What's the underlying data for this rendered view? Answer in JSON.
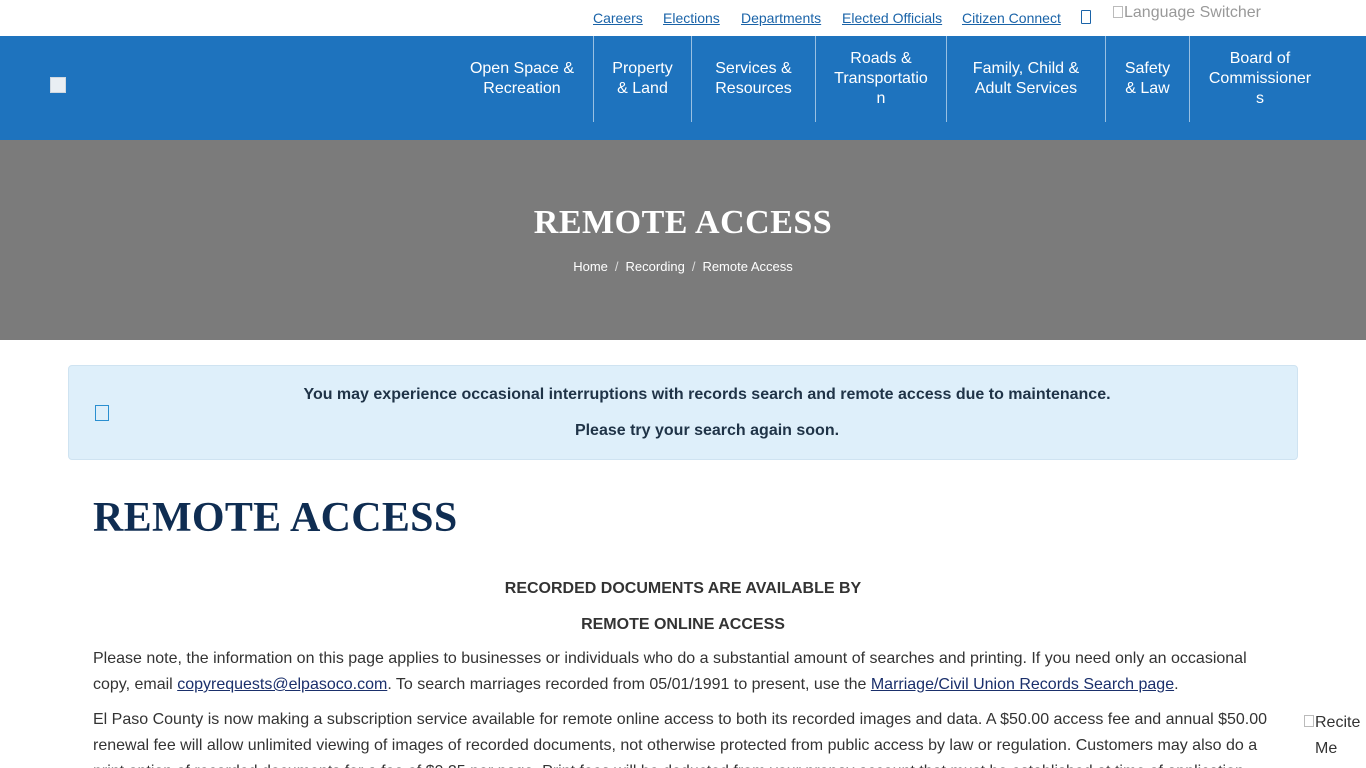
{
  "utility_links": [
    "Careers",
    "Elections",
    "Departments",
    "Elected Officials",
    "Citizen Connect"
  ],
  "language_switcher_alt": "Language Switcher",
  "nav": {
    "items": [
      {
        "line1": "Open Space &",
        "line2": "Recreation",
        "line3": ""
      },
      {
        "line1": "Property",
        "line2": "& Land",
        "line3": ""
      },
      {
        "line1": "Services &",
        "line2": "Resources",
        "line3": ""
      },
      {
        "line1": "Roads &",
        "line2": "Transportatio",
        "line3": "n"
      },
      {
        "line1": "Family, Child &",
        "line2": "Adult Services",
        "line3": ""
      },
      {
        "line1": "Safety",
        "line2": "& Law",
        "line3": ""
      },
      {
        "line1": "Board of",
        "line2": "Commissioner",
        "line3": "s"
      }
    ]
  },
  "hero": {
    "title": "REMOTE ACCESS",
    "breadcrumb": [
      "Home",
      "Recording",
      "Remote Access"
    ]
  },
  "alert": {
    "line1": "You may experience occasional interruptions with records search and remote access due to maintenance.",
    "line2": "Please try your search again soon."
  },
  "content": {
    "heading": "REMOTE ACCESS",
    "sub1": "RECORDED DOCUMENTS ARE AVAILABLE BY",
    "sub2": "REMOTE ONLINE ACCESS",
    "para1_a": "Please note, the information on this page applies to businesses or individuals who do a substantial amount of searches and printing. If you need only an occasional copy, email ",
    "para1_email": "copyrequests@elpasoco.com",
    "para1_b": ". To search marriages recorded from 05/01/1991 to present, use the ",
    "para1_link": "Marriage/Civil Union Records Search page",
    "para1_c": ".",
    "para2": "El Paso County is now making a subscription service available for remote online access to both its recorded images and data. A $50.00 access fee and annual $50.00 renewal fee will allow unlimited viewing of images of recorded documents, not otherwise protected from public access by law or regulation. Customers may also do a print option of recorded documents for a fee of $0.25 per page. Print fees will be deducted from your prepay account that must be established at time of application."
  },
  "recite_me": "Recite Me",
  "colors": {
    "nav_bg": "#1e73be",
    "hero_bg": "#7b7b7b",
    "alert_bg": "#deeffa",
    "heading": "#0f2d52",
    "link": "#1a63a8"
  }
}
